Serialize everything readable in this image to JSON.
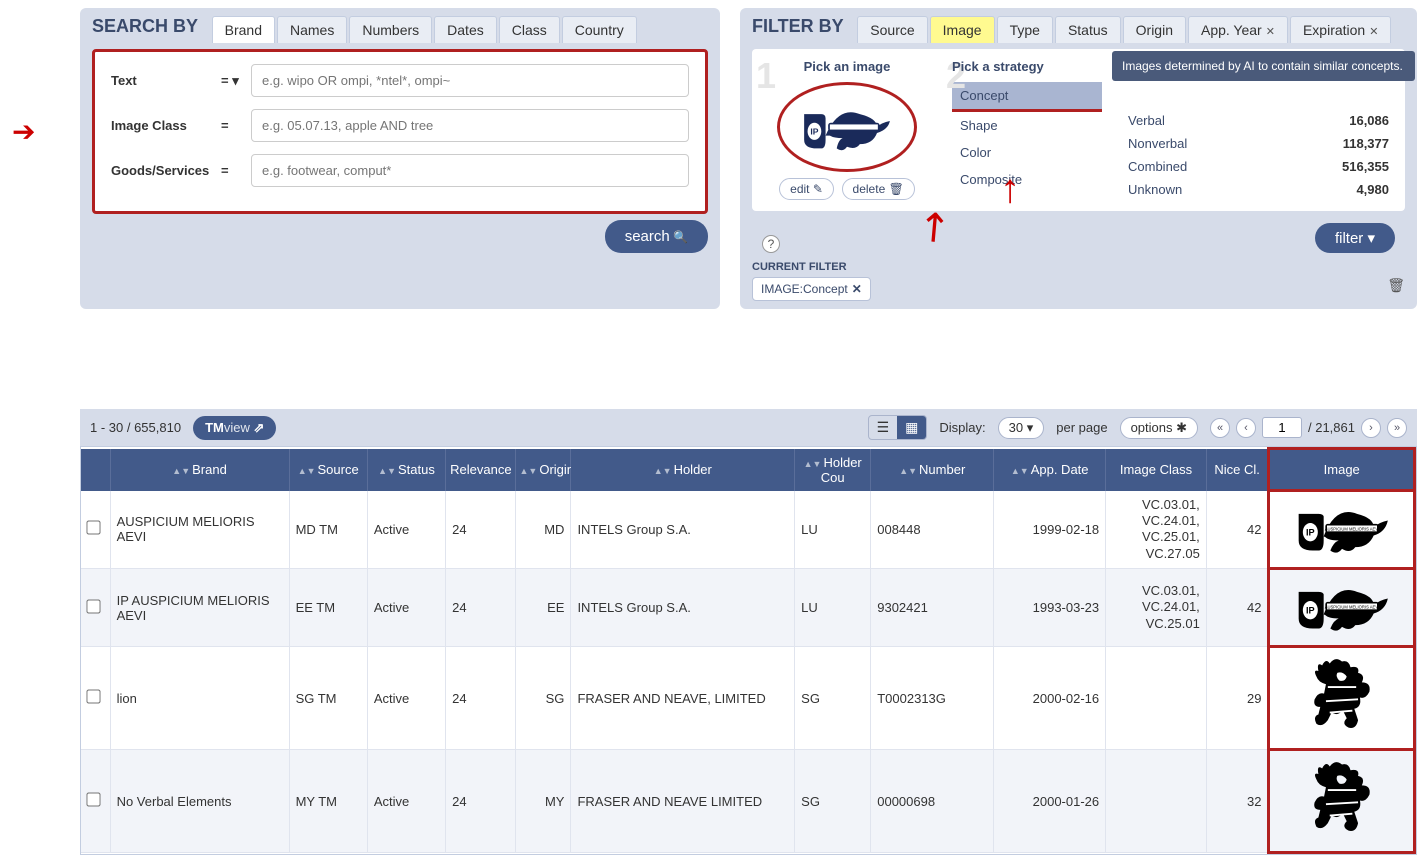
{
  "search": {
    "title": "SEARCH BY",
    "tabs": [
      "Brand",
      "Names",
      "Numbers",
      "Dates",
      "Class",
      "Country"
    ],
    "active_tab": 0,
    "rows": [
      {
        "label": "Text",
        "op": "= ▾",
        "placeholder": "e.g. wipo OR ompi, *ntel*, ompi~"
      },
      {
        "label": "Image Class",
        "op": "=",
        "placeholder": "e.g. 05.07.13, apple AND tree"
      },
      {
        "label": "Goods/Services",
        "op": "=",
        "placeholder": "e.g. footwear, comput*"
      }
    ],
    "button": "search"
  },
  "filter": {
    "title": "FILTER BY",
    "tabs": [
      {
        "label": "Source",
        "closable": false
      },
      {
        "label": "Image",
        "closable": false,
        "highlight": true
      },
      {
        "label": "Type",
        "closable": false
      },
      {
        "label": "Status",
        "closable": false
      },
      {
        "label": "Origin",
        "closable": false
      },
      {
        "label": "App. Year",
        "closable": true
      },
      {
        "label": "Expiration",
        "closable": true
      }
    ],
    "step1": {
      "num": "1",
      "title": "Pick an image",
      "edit": "edit",
      "delete": "delete"
    },
    "step2": {
      "num": "2",
      "title": "Pick a strategy",
      "items": [
        "Concept",
        "Shape",
        "Color",
        "Composite"
      ],
      "selected": 0
    },
    "step3": {
      "tooltip": "Images determined by AI to contain similar concepts.",
      "counts": [
        {
          "label": "Verbal",
          "n": "16,086"
        },
        {
          "label": "Nonverbal",
          "n": "118,377"
        },
        {
          "label": "Combined",
          "n": "516,355"
        },
        {
          "label": "Unknown",
          "n": "4,980"
        }
      ]
    },
    "help": "?",
    "filter_button": "filter",
    "current_label": "CURRENT FILTER",
    "chip": "IMAGE:Concept"
  },
  "toolbar": {
    "range": "1 - 30 / 655,810",
    "tmview": {
      "bold": "TM",
      "light": "view"
    },
    "display_label": "Display:",
    "per_page": "30",
    "per_page_suffix": "per page",
    "options": "options",
    "page_input": "1",
    "page_total": "/ 21,861"
  },
  "columns": [
    "",
    "Brand",
    "Source",
    "Status",
    "Relevance",
    "Origin",
    "Holder",
    "Holder Cou",
    "Number",
    "App. Date",
    "Image Class",
    "Nice Cl.",
    "Image"
  ],
  "rows": [
    {
      "brand": "AUSPICIUM MELIORIS AEVI",
      "source": "MD TM",
      "status": "Active",
      "relevance": "24",
      "origin": "MD",
      "holder": "INTELS Group S.A.",
      "hc": "LU",
      "number": "008448",
      "appdate": "1999-02-18",
      "imgclass": "VC.03.01, VC.24.01, VC.25.01, VC.27.05",
      "nice": "42",
      "imgtype": "shield"
    },
    {
      "brand": "IP AUSPICIUM MELIORIS AEVI",
      "source": "EE TM",
      "status": "Active",
      "relevance": "24",
      "origin": "EE",
      "holder": "INTELS Group S.A.",
      "hc": "LU",
      "number": "9302421",
      "appdate": "1993-03-23",
      "imgclass": "VC.03.01, VC.24.01, VC.25.01",
      "nice": "42",
      "imgtype": "shield"
    },
    {
      "brand": "lion",
      "source": "SG TM",
      "status": "Active",
      "relevance": "24",
      "origin": "SG",
      "holder": "FRASER AND NEAVE, LIMITED",
      "hc": "SG",
      "number": "T0002313G",
      "appdate": "2000-02-16",
      "imgclass": "",
      "nice": "29",
      "imgtype": "lion"
    },
    {
      "brand": "No Verbal Elements",
      "source": "MY TM",
      "status": "Active",
      "relevance": "24",
      "origin": "MY",
      "holder": "FRASER AND NEAVE LIMITED",
      "hc": "SG",
      "number": "00000698",
      "appdate": "2000-01-26",
      "imgclass": "",
      "nice": "32",
      "imgtype": "lion"
    }
  ]
}
